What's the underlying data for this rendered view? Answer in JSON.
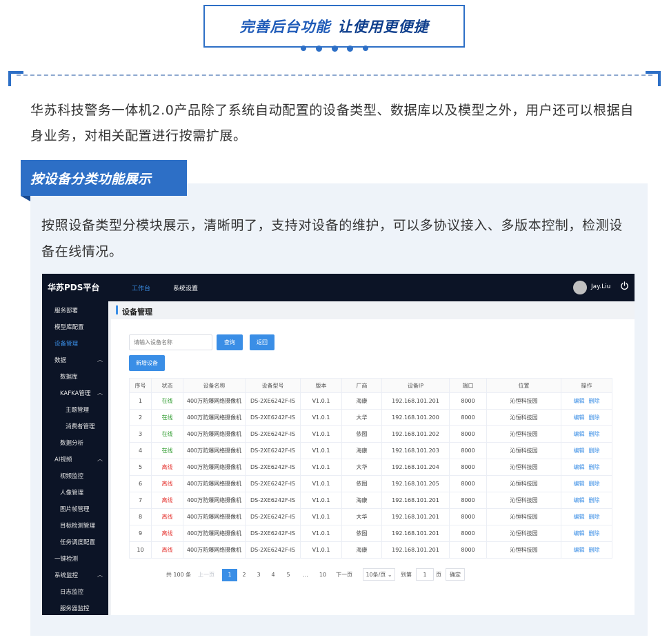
{
  "banner": {
    "title_a": "完善后台功能",
    "title_b": "让使用更便捷"
  },
  "intro": "华苏科技警务一体机2.0产品除了系统自动配置的设备类型、数据库以及模型之外，用户还可以根据自身业务，对相关配置进行按需扩展。",
  "section": {
    "tag": "按设备分类功能展示",
    "desc": "按照设备类型分模块展示，清晰明了，支持对设备的维护，可以多协议接入、多版本控制，检测设备在线情况。"
  },
  "app": {
    "logo": "华苏PDS平台",
    "nav": [
      "工作台",
      "系统设置"
    ],
    "user": "Jay.Liu",
    "sidebar": [
      "服务部署",
      "模型库配置",
      "设备管理",
      "数据",
      "数据库",
      "KAFKA管理",
      "主题管理",
      "消费者管理",
      "数据分析",
      "AI视频",
      "视频监控",
      "人像管理",
      "图片帧管理",
      "目标检测管理",
      "任务调度配置",
      "一键检测",
      "系统监控",
      "日志监控",
      "服务器监控"
    ],
    "page_title": "设备管理",
    "search_placeholder": "请输入设备名称",
    "btn_query": "查询",
    "btn_back": "返回",
    "btn_add": "新增设备",
    "table": {
      "headers": [
        "序号",
        "状态",
        "设备名称",
        "设备型号",
        "版本",
        "厂商",
        "设备IP",
        "端口",
        "位置",
        "操作"
      ],
      "edit": "编辑",
      "delete": "删除",
      "rows": [
        [
          "1",
          "在线",
          "400万防爆网络摄像机",
          "DS-2XE6242F-IS",
          "V1.0.1",
          "海康",
          "192.168.101.201",
          "8000",
          "沁恒科技园"
        ],
        [
          "2",
          "在线",
          "400万防爆网络摄像机",
          "DS-2XE6242F-IS",
          "V1.0.1",
          "大华",
          "192.168.101.200",
          "8000",
          "沁恒科技园"
        ],
        [
          "3",
          "在线",
          "400万防爆网络摄像机",
          "DS-2XE6242F-IS",
          "V1.0.1",
          "依图",
          "192.168.101.202",
          "8000",
          "沁恒科技园"
        ],
        [
          "4",
          "在线",
          "400万防爆网络摄像机",
          "DS-2XE6242F-IS",
          "V1.0.1",
          "海康",
          "192.168.101.203",
          "8000",
          "沁恒科技园"
        ],
        [
          "5",
          "离线",
          "400万防爆网络摄像机",
          "DS-2XE6242F-IS",
          "V1.0.1",
          "大华",
          "192.168.101.204",
          "8000",
          "沁恒科技园"
        ],
        [
          "6",
          "离线",
          "400万防爆网络摄像机",
          "DS-2XE6242F-IS",
          "V1.0.1",
          "依图",
          "192.168.101.205",
          "8000",
          "沁恒科技园"
        ],
        [
          "7",
          "离线",
          "400万防爆网络摄像机",
          "DS-2XE6242F-IS",
          "V1.0.1",
          "海康",
          "192.168.101.201",
          "8000",
          "沁恒科技园"
        ],
        [
          "8",
          "离线",
          "400万防爆网络摄像机",
          "DS-2XE6242F-IS",
          "V1.0.1",
          "大华",
          "192.168.101.201",
          "8000",
          "沁恒科技园"
        ],
        [
          "9",
          "离线",
          "400万防爆网络摄像机",
          "DS-2XE6242F-IS",
          "V1.0.1",
          "依图",
          "192.168.101.201",
          "8000",
          "沁恒科技园"
        ],
        [
          "10",
          "离线",
          "400万防爆网络摄像机",
          "DS-2XE6242F-IS",
          "V1.0.1",
          "海康",
          "192.168.101.201",
          "8000",
          "沁恒科技园"
        ]
      ]
    },
    "pager": {
      "total": "共 100 条",
      "prev": "上一页",
      "pages": [
        "1",
        "2",
        "3",
        "4",
        "5",
        "...",
        "10"
      ],
      "next": "下一页",
      "size": "10条/页",
      "goto": "到第",
      "goto_value": "1",
      "page_unit": "页",
      "confirm": "确定"
    }
  },
  "colors": {
    "brand_blue": "#2d6fc6",
    "app_dark": "#0c1426",
    "accent": "#3a8ee6",
    "online": "#2e9b2e",
    "offline": "#e53935"
  }
}
